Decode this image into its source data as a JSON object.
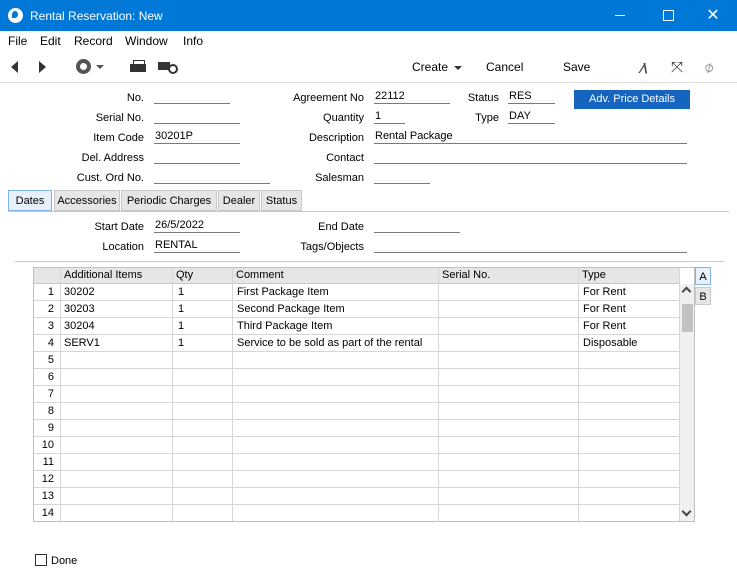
{
  "window": {
    "title": "Rental Reservation: New"
  },
  "menu": [
    "File",
    "Edit",
    "Record",
    "Window",
    "Info"
  ],
  "toolbar": {
    "create": "Create",
    "cancel": "Cancel",
    "save": "Save"
  },
  "header": {
    "no_label": "No.",
    "no_value": "",
    "serial_label": "Serial No.",
    "serial_value": "",
    "item_code_label": "Item Code",
    "item_code_value": "30201P",
    "del_address_label": "Del. Address",
    "del_address_value": "",
    "cust_ord_label": "Cust. Ord No.",
    "cust_ord_value": "",
    "agreement_label": "Agreement No",
    "agreement_value": "22112",
    "quantity_label": "Quantity",
    "quantity_value": "1",
    "description_label": "Description",
    "description_value": "Rental Package",
    "contact_label": "Contact",
    "contact_value": "",
    "salesman_label": "Salesman",
    "salesman_value": "",
    "status_label": "Status",
    "status_value": "RES",
    "type_label": "Type",
    "type_value": "DAY",
    "adv_button": "Adv. Price Details"
  },
  "tabs": [
    "Dates",
    "Accessories",
    "Periodic Charges",
    "Dealer",
    "Status"
  ],
  "dates": {
    "start_label": "Start Date",
    "start_value": "26/5/2022",
    "end_label": "End Date",
    "end_value": "",
    "location_label": "Location",
    "location_value": "RENTAL",
    "tags_label": "Tags/Objects",
    "tags_value": ""
  },
  "grid": {
    "columns": [
      "Additional Items",
      "Qty",
      "Comment",
      "Serial No.",
      "Type"
    ],
    "rows": [
      {
        "num": "1",
        "item": "30202",
        "qty": "1",
        "comment": "First Package Item",
        "serial": "",
        "type": "For Rent"
      },
      {
        "num": "2",
        "item": "30203",
        "qty": "1",
        "comment": "Second Package Item",
        "serial": "",
        "type": "For Rent"
      },
      {
        "num": "3",
        "item": "30204",
        "qty": "1",
        "comment": "Third Package Item",
        "serial": "",
        "type": "For Rent"
      },
      {
        "num": "4",
        "item": "SERV1",
        "qty": "1",
        "comment": "Service to be sold as part of the rental",
        "serial": "",
        "type": "Disposable"
      },
      {
        "num": "5",
        "item": "",
        "qty": "",
        "comment": "",
        "serial": "",
        "type": ""
      },
      {
        "num": "6",
        "item": "",
        "qty": "",
        "comment": "",
        "serial": "",
        "type": ""
      },
      {
        "num": "7",
        "item": "",
        "qty": "",
        "comment": "",
        "serial": "",
        "type": ""
      },
      {
        "num": "8",
        "item": "",
        "qty": "",
        "comment": "",
        "serial": "",
        "type": ""
      },
      {
        "num": "9",
        "item": "",
        "qty": "",
        "comment": "",
        "serial": "",
        "type": ""
      },
      {
        "num": "10",
        "item": "",
        "qty": "",
        "comment": "",
        "serial": "",
        "type": ""
      },
      {
        "num": "11",
        "item": "",
        "qty": "",
        "comment": "",
        "serial": "",
        "type": ""
      },
      {
        "num": "12",
        "item": "",
        "qty": "",
        "comment": "",
        "serial": "",
        "type": ""
      },
      {
        "num": "13",
        "item": "",
        "qty": "",
        "comment": "",
        "serial": "",
        "type": ""
      },
      {
        "num": "14",
        "item": "",
        "qty": "",
        "comment": "",
        "serial": "",
        "type": ""
      }
    ],
    "side_tabs": [
      "A",
      "B"
    ]
  },
  "done_label": "Done"
}
